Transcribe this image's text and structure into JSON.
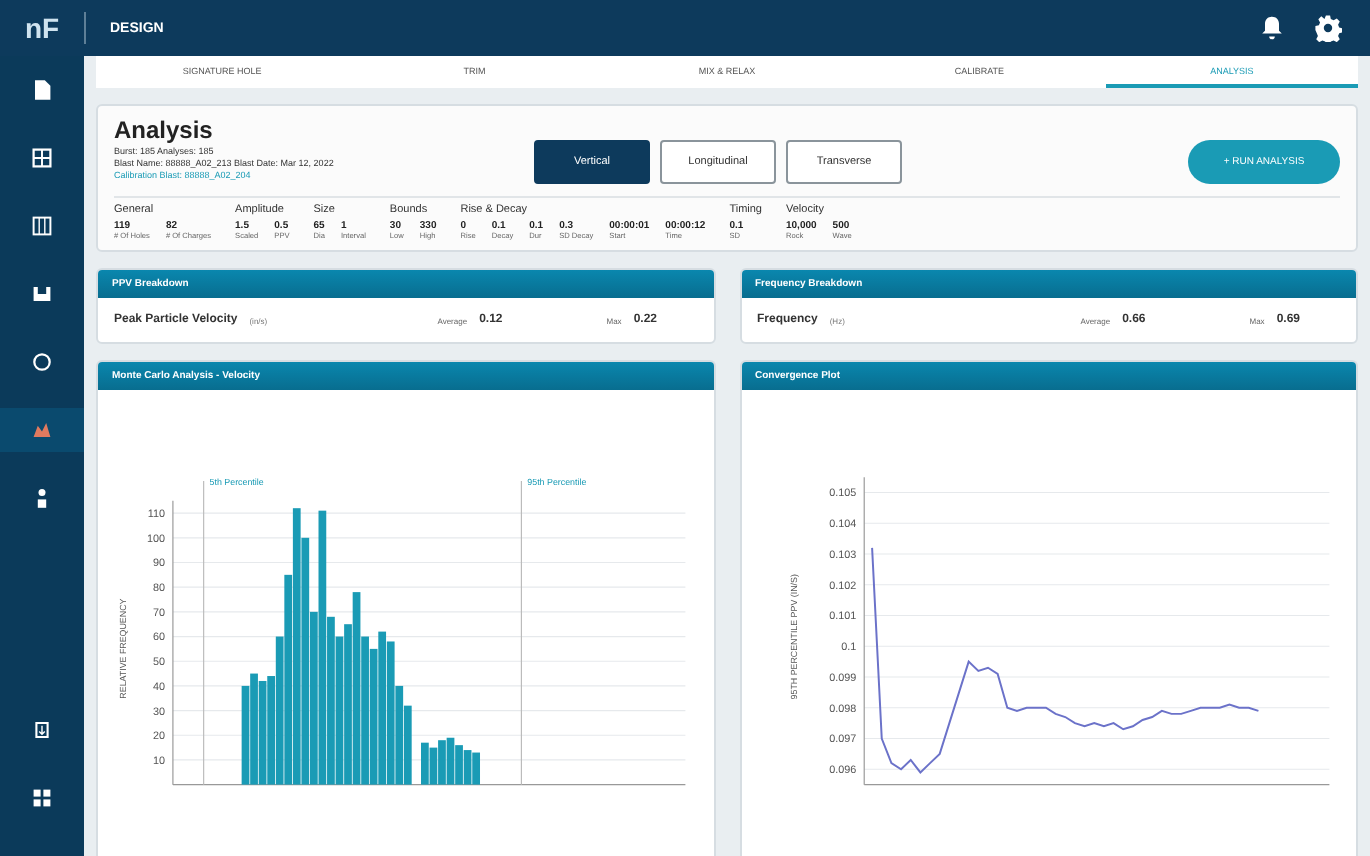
{
  "app": {
    "logo": "nF",
    "section": "DESIGN"
  },
  "sidebar": {
    "items": [
      {
        "kind": "file",
        "selected": false
      },
      {
        "kind": "grid",
        "selected": false
      },
      {
        "kind": "columns",
        "selected": false
      },
      {
        "kind": "tray",
        "selected": false
      },
      {
        "kind": "circle",
        "selected": false
      },
      {
        "kind": "blast",
        "selected": true
      },
      {
        "kind": "person",
        "selected": false
      }
    ],
    "bottom": [
      {
        "kind": "export"
      },
      {
        "kind": "apps"
      }
    ]
  },
  "tabs": [
    {
      "label": "SIGNATURE HOLE",
      "selected": false
    },
    {
      "label": "TRIM",
      "selected": false
    },
    {
      "label": "MIX & RELAX",
      "selected": false
    },
    {
      "label": "CALIBRATE",
      "selected": false
    },
    {
      "label": "ANALYSIS",
      "selected": true
    }
  ],
  "analysis": {
    "title": "Analysis",
    "lines": [
      "Burst: 185  Analyses: 185",
      "Blast Name: 88888_A02_213  Blast Date: Mar 12, 2022"
    ],
    "calibration": "Calibration Blast: 88888_A02_204",
    "modes": [
      {
        "label": "Vertical",
        "selected": true
      },
      {
        "label": "Longitudinal",
        "selected": false
      },
      {
        "label": "Transverse",
        "selected": false
      }
    ],
    "run_button": "+ RUN ANALYSIS",
    "groups": [
      {
        "label": "General",
        "items": [
          {
            "value": "119",
            "label": "# Of Holes"
          },
          {
            "value": "82",
            "label": "# Of Charges"
          }
        ]
      },
      {
        "label": "Amplitude",
        "items": [
          {
            "value": "1.5",
            "label": "Scaled"
          },
          {
            "value": "0.5",
            "label": "PPV"
          }
        ]
      },
      {
        "label": "Size",
        "items": [
          {
            "value": "65",
            "label": "Dia"
          },
          {
            "value": "1",
            "label": "Interval"
          }
        ]
      },
      {
        "label": "Bounds",
        "items": [
          {
            "value": "30",
            "label": "Low"
          },
          {
            "value": "330",
            "label": "High"
          }
        ]
      },
      {
        "label": "Rise & Decay",
        "items": [
          {
            "value": "0",
            "label": "Rise"
          },
          {
            "value": "0.1",
            "label": "Decay"
          },
          {
            "value": "0.1",
            "label": "Dur"
          },
          {
            "value": "0.3",
            "label": "SD Decay"
          },
          {
            "value": "00:00:01",
            "label": "Start"
          },
          {
            "value": "00:00:12",
            "label": "Time"
          }
        ]
      },
      {
        "label": "Timing",
        "items": [
          {
            "value": "0.1",
            "label": "SD"
          }
        ]
      },
      {
        "label": "Velocity",
        "items": [
          {
            "value": "10,000",
            "label": "Rock"
          },
          {
            "value": "500",
            "label": "Wave"
          }
        ]
      }
    ]
  },
  "breakdowns": [
    {
      "title": "PPV Breakdown",
      "metric": "Peak Particle Velocity",
      "unit": "(in/s)",
      "average_label": "Average",
      "average": "0.12",
      "max_label": "Max",
      "max": "0.22"
    },
    {
      "title": "Frequency Breakdown",
      "metric": "Frequency",
      "unit": "(Hz)",
      "average_label": "Average",
      "average": "0.66",
      "max_label": "Max",
      "max": "0.69"
    }
  ],
  "charts": [
    {
      "title": "Monte Carlo Analysis - Velocity",
      "markers": [
        {
          "label": "5th Percentile"
        },
        {
          "label": "95th Percentile"
        }
      ],
      "chart_data": {
        "type": "bar",
        "ylabel": "RELATIVE FREQUENCY",
        "ylim": [
          0,
          115
        ],
        "yticks": [
          10,
          20,
          30,
          40,
          50,
          60,
          70,
          80,
          90,
          100,
          110
        ],
        "grid": true,
        "series": [
          {
            "color": "#1a9bb5",
            "values": [
              null,
              null,
              null,
              null,
              null,
              null,
              null,
              null,
              40,
              45,
              42,
              44,
              60,
              85,
              112,
              100,
              70,
              111,
              68,
              60,
              65,
              78,
              60,
              55,
              62,
              58,
              40,
              32,
              null,
              17,
              15,
              18,
              19,
              16,
              14,
              13,
              null,
              null,
              null,
              null,
              null,
              null,
              null,
              null,
              null,
              null,
              null,
              null,
              null,
              null,
              null,
              null,
              null,
              null,
              null,
              null,
              null,
              null,
              null,
              null
            ]
          }
        ]
      }
    },
    {
      "title": "Convergence Plot",
      "chart_data": {
        "type": "line",
        "ylabel": "95TH PERCENTILE PPV (IN/S)",
        "ylim": [
          0.0955,
          0.1055
        ],
        "grid": true,
        "yticks": [
          {
            "value": 0.105,
            "label": "0.105"
          },
          {
            "value": 0.104,
            "label": "0.104"
          },
          {
            "value": 0.103,
            "label": "0.103"
          },
          {
            "value": 0.102,
            "label": "0.102"
          },
          {
            "value": 0.101,
            "label": "0.101"
          },
          {
            "value": 0.1,
            "label": "0.1"
          },
          {
            "value": 0.099,
            "label": "0.099"
          },
          {
            "value": 0.098,
            "label": "0.098"
          },
          {
            "value": 0.097,
            "label": "0.097"
          },
          {
            "value": 0.096,
            "label": "0.096"
          }
        ],
        "series": [
          {
            "color": "#6b72c9",
            "values": [
              0.1032,
              0.097,
              0.0962,
              0.096,
              0.0963,
              0.0959,
              0.0962,
              0.0965,
              0.0975,
              0.0985,
              0.0995,
              0.0992,
              0.0993,
              0.0991,
              0.098,
              0.0979,
              0.098,
              0.098,
              0.098,
              0.0978,
              0.0977,
              0.0975,
              0.0974,
              0.0975,
              0.0974,
              0.0975,
              0.0973,
              0.0974,
              0.0976,
              0.0977,
              0.0979,
              0.0978,
              0.0978,
              0.0979,
              0.098,
              0.098,
              0.098,
              0.0981,
              0.098,
              0.098,
              0.0979
            ]
          }
        ]
      }
    }
  ]
}
